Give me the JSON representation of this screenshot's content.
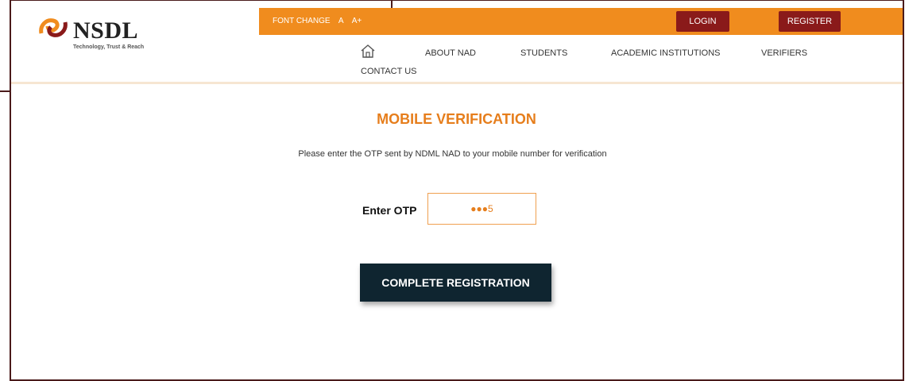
{
  "logo": {
    "text": "NSDL",
    "tagline": "Technology, Trust & Reach"
  },
  "topbar": {
    "font_change_label": "FONT CHANGE",
    "font_small": "A",
    "font_large": "A+",
    "login_label": "LOGIN",
    "register_label": "REGISTER"
  },
  "nav": {
    "items": [
      {
        "label": "ABOUT NAD"
      },
      {
        "label": "STUDENTS"
      },
      {
        "label": "ACADEMIC INSTITUTIONS"
      },
      {
        "label": "VERIFIERS"
      },
      {
        "label": "CONTACT US"
      }
    ]
  },
  "main": {
    "title": "MOBILE VERIFICATION",
    "instructions": "Please enter the OTP sent by NDML NAD to your mobile number for verification",
    "otp_label": "Enter OTP",
    "otp_value": "●●●5",
    "submit_label": "COMPLETE REGISTRATION"
  },
  "colors": {
    "accent": "#f08c1e",
    "title": "#e67e1c",
    "button_dark": "#0f2530",
    "auth_button": "#8a1a1a"
  }
}
